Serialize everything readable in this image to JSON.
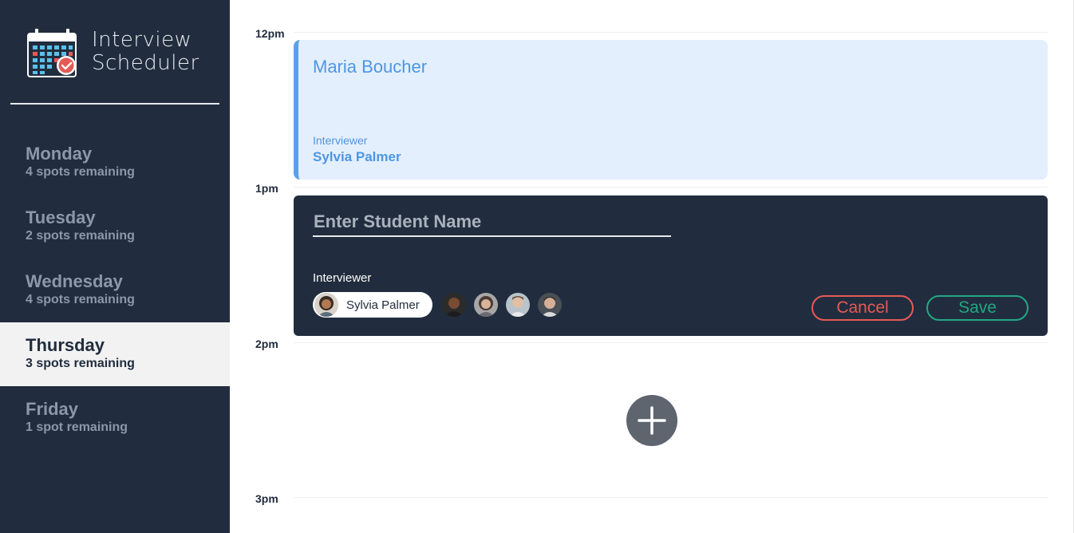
{
  "app": {
    "title_line1": "Interview",
    "title_line2": "Scheduler"
  },
  "days": [
    {
      "name": "Monday",
      "spots": "4 spots remaining",
      "selected": false
    },
    {
      "name": "Tuesday",
      "spots": "2 spots remaining",
      "selected": false
    },
    {
      "name": "Wednesday",
      "spots": "4 spots remaining",
      "selected": false
    },
    {
      "name": "Thursday",
      "spots": "3 spots remaining",
      "selected": true
    },
    {
      "name": "Friday",
      "spots": "1 spot remaining",
      "selected": false
    }
  ],
  "times": [
    "12pm",
    "1pm",
    "2pm",
    "3pm"
  ],
  "appointment": {
    "student": "Maria Boucher",
    "interviewer_label": "Interviewer",
    "interviewer_name": "Sylvia Palmer"
  },
  "form": {
    "placeholder": "Enter Student Name",
    "interviewer_label": "Interviewer",
    "selected_interviewer": "Sylvia Palmer",
    "cancel_label": "Cancel",
    "save_label": "Save"
  },
  "colors": {
    "sidebar_bg": "#212d3e",
    "accent_blue": "#4d96e4",
    "cancel_red": "#e55a56",
    "save_green": "#22a884"
  },
  "icons": {
    "logo": "calendar-check-icon",
    "add": "plus-icon"
  }
}
